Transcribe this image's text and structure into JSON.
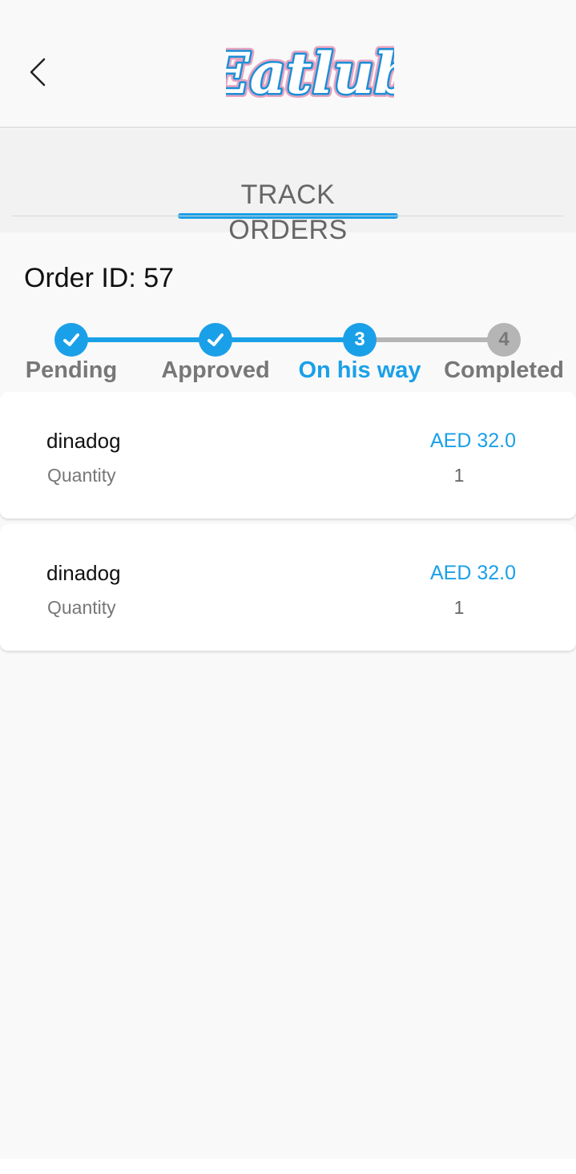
{
  "header": {
    "back_icon": "chevron-left-icon",
    "logo_text": "Eatlub"
  },
  "tabs": [
    {
      "label": "TRACK ORDERS",
      "active": true
    }
  ],
  "order": {
    "id_label": "Order ID: 57"
  },
  "steps": [
    {
      "label": "Pending",
      "marker": "✓",
      "state": "done"
    },
    {
      "label": "Approved",
      "marker": "✓",
      "state": "done"
    },
    {
      "label": "On his way",
      "marker": "3",
      "state": "current"
    },
    {
      "label": "Completed",
      "marker": "4",
      "state": "pending"
    }
  ],
  "items": [
    {
      "name": "dinadog",
      "price": "AED 32.0",
      "quantity_label": "Quantity",
      "quantity": "1"
    },
    {
      "name": "dinadog",
      "price": "AED 32.0",
      "quantity_label": "Quantity",
      "quantity": "1"
    }
  ],
  "colors": {
    "accent": "#1aa0e8",
    "inactive": "#b5b5b5",
    "label_done": "#777777",
    "logo_shadow": "#e6a3c0"
  }
}
